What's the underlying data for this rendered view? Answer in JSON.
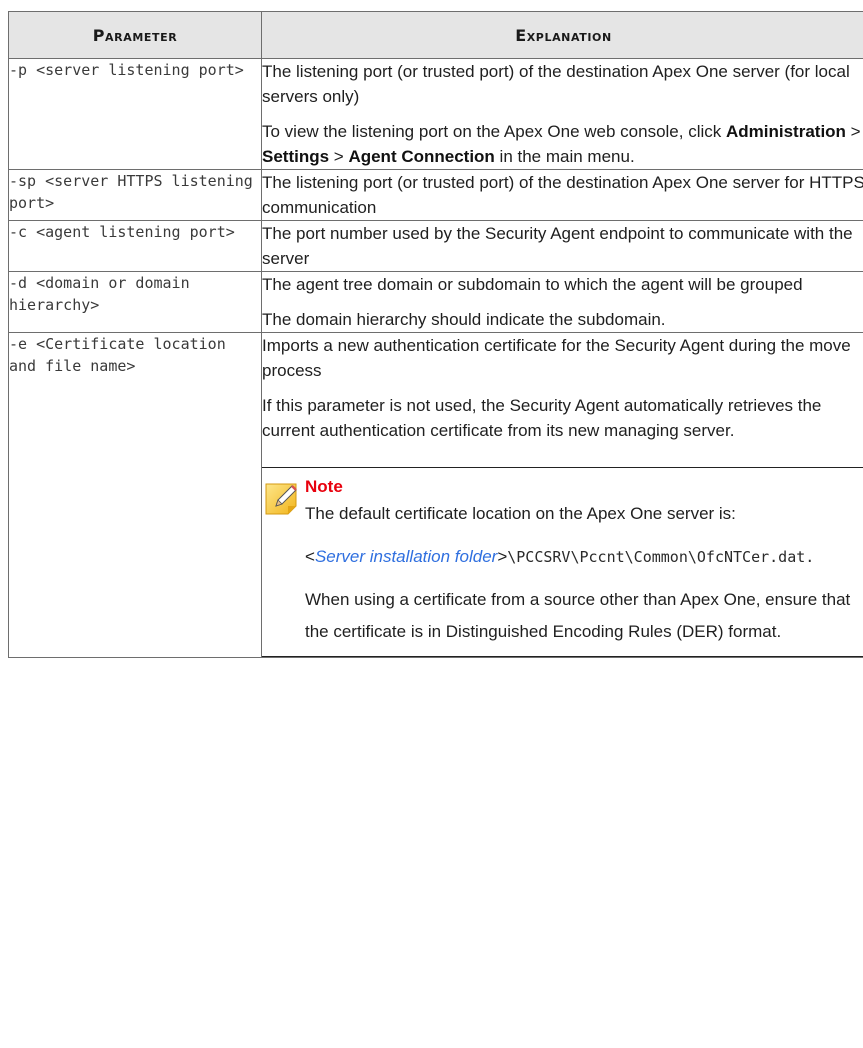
{
  "table": {
    "headers": {
      "param": "Parameter",
      "explanation": "Explanation"
    },
    "rows": [
      {
        "param": "-p <server listening port>",
        "lines": [
          "The listening port (or trusted port) of the destination Apex One server (for local servers only)"
        ],
        "nav": {
          "prefix": "To view the listening port on the Apex One web console, click ",
          "item1": "Administration",
          "sep1": " > ",
          "item2": "Settings",
          "sep2": " > ",
          "item3": "Agent Connection",
          "suffix": " in the main menu."
        }
      },
      {
        "param": "-sp <server HTTPS listening port>",
        "lines": [
          "The listening port (or trusted port) of the destination Apex One server for HTTPS communication"
        ]
      },
      {
        "param": "-c <agent listening port>",
        "lines": [
          "The port number used by the Security Agent endpoint to communicate with the server"
        ]
      },
      {
        "param": "-d <domain or domain hierarchy>",
        "lines": [
          "The agent tree domain or subdomain to which the agent will be grouped",
          "The domain hierarchy should indicate the subdomain."
        ]
      },
      {
        "param": "-e <Certificate location and file name>",
        "lines": [
          "Imports a new authentication certificate for the Security Agent during the move process",
          "If this parameter is not used, the Security Agent automatically retrieves the current authentication certificate from its new managing server."
        ],
        "note": {
          "title": "Note",
          "icon": "note-pencil-icon",
          "line1": "The default certificate location on the Apex One server is:",
          "path_open": "<",
          "path_link": "Server installation folder",
          "path_close": ">",
          "path_rest": "\\PCCSRV\\Pccnt\\Common\\OfcNTCer.dat.",
          "line2": "When using a certificate from a source other than Apex One, ensure that the certificate is in Distinguished Encoding Rules (DER) format."
        }
      }
    ]
  },
  "colors": {
    "header_bg": "#e5e5e5",
    "note_title": "#e8000d",
    "link": "#2f6fdf",
    "icon_yellow": "#f5c518"
  }
}
